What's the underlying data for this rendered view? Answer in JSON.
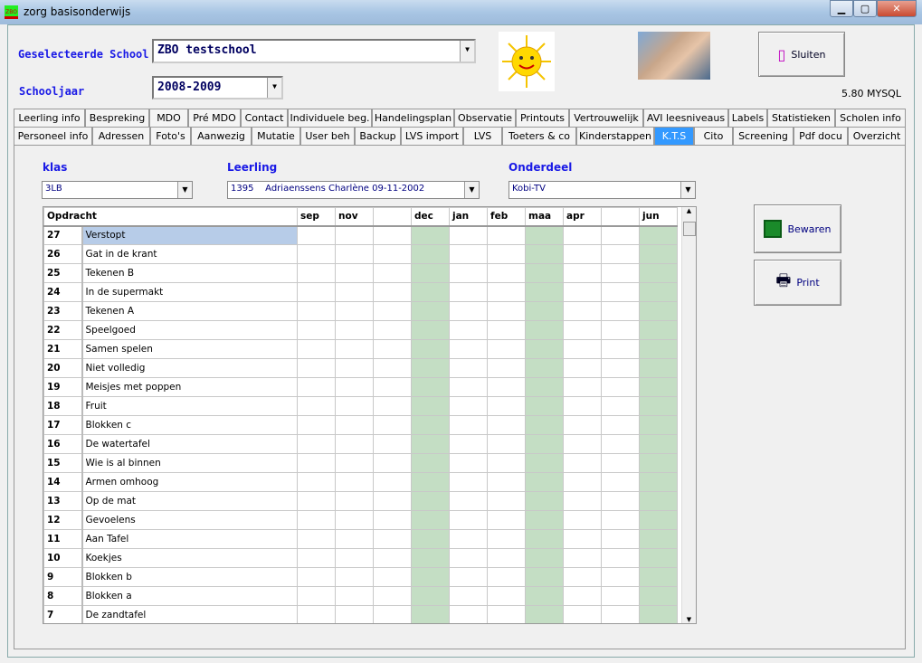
{
  "window": {
    "title": "zorg basisonderwijs",
    "icon_text": "ZBO"
  },
  "header": {
    "school_label": "Geselecteerde School :",
    "school_value": "ZBO testschool",
    "year_label": "Schooljaar",
    "year_value": "2008-2009",
    "close_button": "Sluiten",
    "version": "5.80 MYSQL"
  },
  "tabs_row1": [
    "Leerling info",
    "Bespreking",
    "MDO",
    "Pré MDO",
    "Contact",
    "Individuele beg.",
    "Handelingsplan",
    "Observatie",
    "Printouts",
    "Vertrouwelijk",
    "AVI leesniveaus",
    "Labels",
    "Statistieken",
    "Scholen info"
  ],
  "tabs_row2": [
    "Personeel info",
    "Adressen",
    "Foto's",
    "Aanwezig",
    "Mutatie",
    "User beh",
    "Backup",
    "LVS import",
    "LVS",
    "Toeters & co",
    "Kinderstappen",
    "K.T.S",
    "Cito",
    "Screening",
    "Pdf docu",
    "Overzicht"
  ],
  "active_tab": "K.T.S",
  "filters": {
    "klas_label": "klas",
    "klas_value": "3LB",
    "leerling_label": "Leerling",
    "leerling_value": "1395    Adriaenssens Charlène 09-11-2002",
    "onderdeel_label": "Onderdeel",
    "onderdeel_value": "Kobi-TV"
  },
  "actions": {
    "save": "Bewaren",
    "print": "Print"
  },
  "grid": {
    "columns": [
      "Opdracht",
      "sep",
      "nov",
      "",
      "dec",
      "jan",
      "feb",
      "maa",
      "apr",
      "",
      "jun"
    ],
    "rows": [
      [
        "27",
        "Verstopt"
      ],
      [
        "26",
        "Gat in de krant"
      ],
      [
        "25",
        "Tekenen B"
      ],
      [
        "24",
        "In de supermakt"
      ],
      [
        "23",
        "Tekenen A"
      ],
      [
        "22",
        "Speelgoed"
      ],
      [
        "21",
        "Samen spelen"
      ],
      [
        "20",
        "Niet volledig"
      ],
      [
        "19",
        "Meisjes met poppen"
      ],
      [
        "18",
        "Fruit"
      ],
      [
        "17",
        "Blokken c"
      ],
      [
        "16",
        "De watertafel"
      ],
      [
        "15",
        "Wie is al binnen"
      ],
      [
        "14",
        "Armen omhoog"
      ],
      [
        "13",
        "Op de mat"
      ],
      [
        "12",
        "Gevoelens"
      ],
      [
        "11",
        "Aan Tafel"
      ],
      [
        "10",
        "Koekjes"
      ],
      [
        "9",
        "Blokken b"
      ],
      [
        "8",
        "Blokken a"
      ],
      [
        "7",
        "De zandtafel"
      ]
    ],
    "selected_row": 0,
    "highlight_color": "#c4dec4"
  }
}
